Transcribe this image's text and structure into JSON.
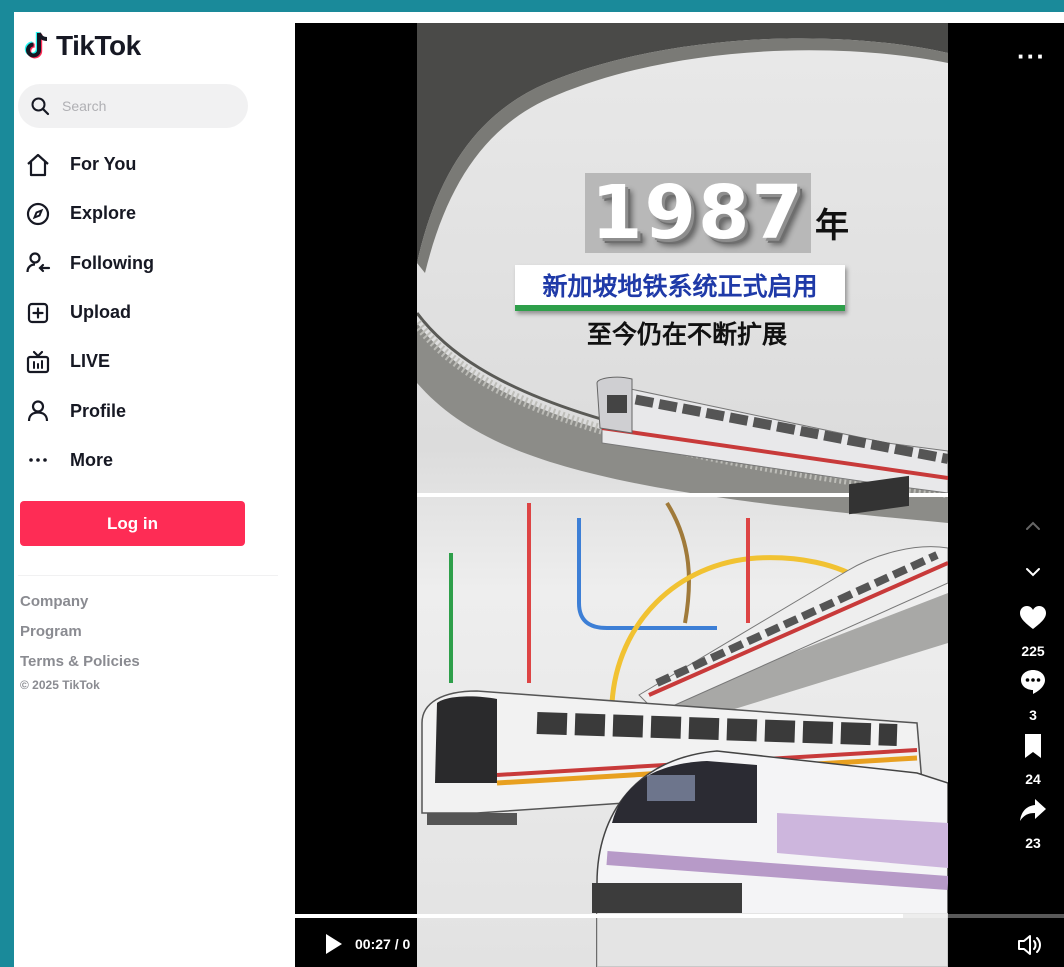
{
  "app": {
    "logo_text": "TikTok"
  },
  "search": {
    "placeholder": "Search"
  },
  "nav": [
    {
      "label": "For You",
      "icon": "home-icon"
    },
    {
      "label": "Explore",
      "icon": "compass-icon"
    },
    {
      "label": "Following",
      "icon": "following-icon"
    },
    {
      "label": "Upload",
      "icon": "upload-icon"
    },
    {
      "label": "LIVE",
      "icon": "live-icon"
    },
    {
      "label": "Profile",
      "icon": "profile-icon"
    },
    {
      "label": "More",
      "icon": "more-dots-icon"
    }
  ],
  "login": {
    "label": "Log in"
  },
  "footer": {
    "links": [
      "Company",
      "Program",
      "Terms & Policies"
    ],
    "copyright": "© 2025 TikTok"
  },
  "video": {
    "year": "1987",
    "year_suffix": "年",
    "headline": "新加坡地铁系统正式启用",
    "subhead": "至今仍在不断扩展"
  },
  "player": {
    "more_label": "···",
    "time": "00:27 / 0",
    "progress": 0.79
  },
  "actions": {
    "likes": "225",
    "comments": "3",
    "saves": "24",
    "shares": "23"
  },
  "colors": {
    "accent": "#fe2c55",
    "text": "#161823",
    "muted": "#8a8b91"
  }
}
